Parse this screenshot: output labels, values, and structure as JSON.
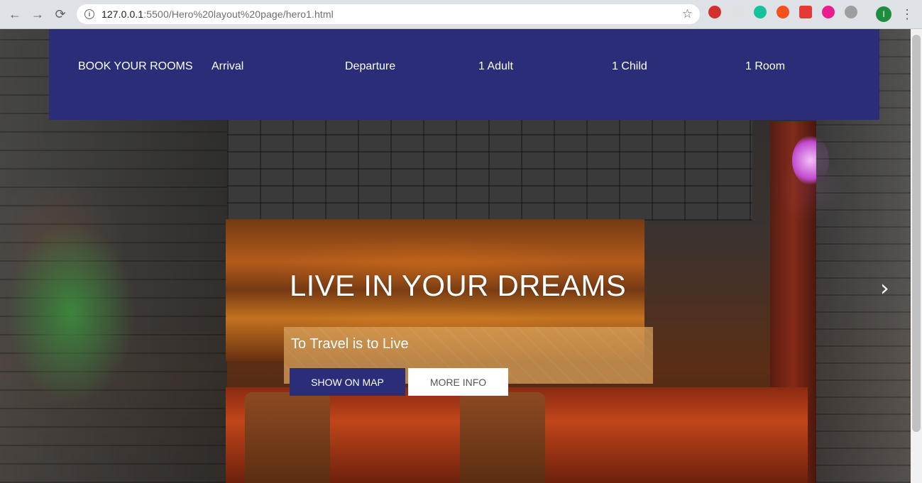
{
  "browser": {
    "url_host": "127.0.0.1",
    "url_path": ":5500/Hero%20layout%20page/hero1.html",
    "profile_initial": "I",
    "extensions": [
      {
        "name": "lastpass-icon",
        "color": "#d32f2f"
      },
      {
        "name": "extension-icon",
        "color": "#bdbdbd"
      },
      {
        "name": "grammarly-icon",
        "color": "#15c39a"
      },
      {
        "name": "extension-icon",
        "color": "#f4511e"
      },
      {
        "name": "extension-icon",
        "color": "#e91e63"
      },
      {
        "name": "extension-icon",
        "color": "#e91e8c"
      },
      {
        "name": "extension-icon",
        "color": "#9e9e9e"
      }
    ]
  },
  "booking": {
    "items": [
      "BOOK YOUR ROOMS",
      "Arrival",
      "Departure",
      "1 Adult",
      "1 Child",
      "1 Room"
    ]
  },
  "hero": {
    "title": "LIVE IN YOUR DREAMS",
    "subtitle": "To Travel is to Live",
    "primary_button": "SHOW ON MAP",
    "secondary_button": "MORE INFO"
  },
  "colors": {
    "brand": "#2b2d78"
  }
}
